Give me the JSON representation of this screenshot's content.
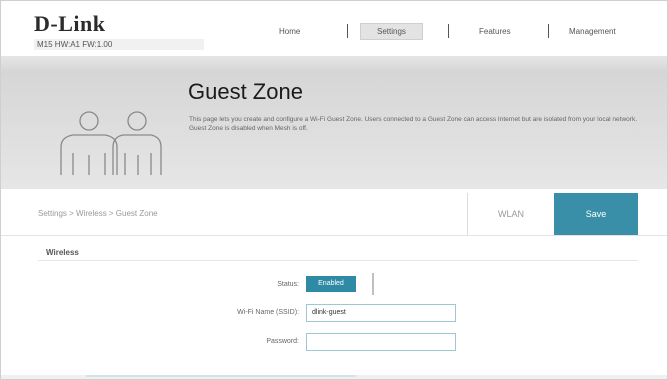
{
  "header": {
    "logo": "D-Link",
    "model_info": "M15 HW:A1 FW:1.00",
    "nav": [
      "Home",
      "Settings",
      "Features",
      "Management"
    ]
  },
  "banner": {
    "title": "Guest Zone",
    "description": "This page lets you create and configure a Wi-Fi Guest Zone. Users connected to a Guest Zone can access Internet but are isolated from your local network. Guest Zone is disabled when Mesh is off."
  },
  "breadcrumb": "Settings > Wireless > Guest Zone",
  "buttons": {
    "wlan": "WLAN",
    "save": "Save"
  },
  "wireless": {
    "section_title": "Wireless",
    "status_label": "Status:",
    "status_value": "Enabled",
    "ssid_label": "Wi-Fi Name (SSID):",
    "ssid_value": "dlink-guest",
    "password_label": "Password:",
    "password_value": ""
  },
  "colors": {
    "accent": "#3a8fa8",
    "toggle": "#2f8aa5"
  }
}
